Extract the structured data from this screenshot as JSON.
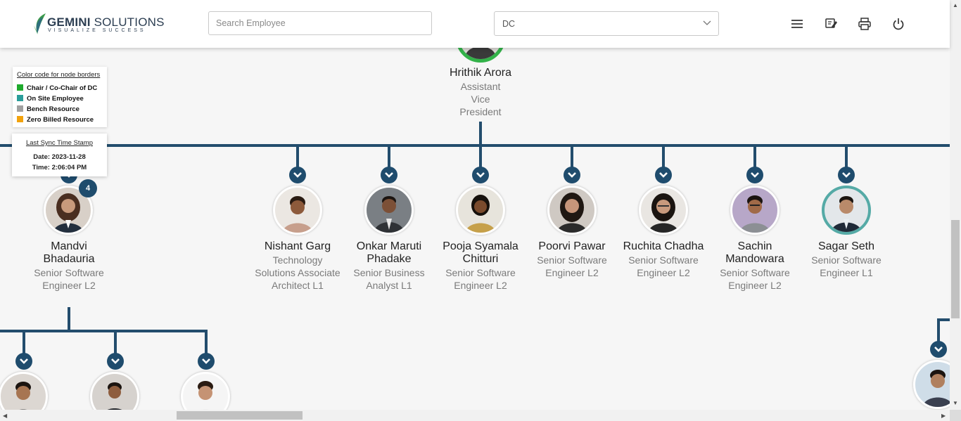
{
  "header": {
    "logo_main": "GEMINI",
    "logo_secondary": "SOLUTIONS",
    "logo_tagline": "VISUALIZE SUCCESS",
    "search_placeholder": "Search Employee",
    "select_value": "DC",
    "icons": [
      "menu-icon",
      "edit-note-icon",
      "print-icon",
      "power-icon"
    ]
  },
  "legend": {
    "title": "Color code for node borders",
    "items": [
      {
        "label": "Chair / Co-Chair of DC",
        "color": "#1faa2d"
      },
      {
        "label": "On Site Employee",
        "color": "#2a9d9a"
      },
      {
        "label": "Bench Resource",
        "color": "#a0a0a0"
      },
      {
        "label": "Zero Billed Resource",
        "color": "#f2a20c"
      }
    ]
  },
  "sync": {
    "title": "Last Sync Time Stamp",
    "date_line": "Date: 2023-11-28",
    "time_line": "Time: 2:06:04 PM"
  },
  "colors": {
    "tree_line": "#234d6d",
    "chair_border": "#33b249",
    "onsite_border": "#55aaa6"
  },
  "root": {
    "name": "Hrithik Arora",
    "role": "Assistant Vice President"
  },
  "level1": [
    {
      "name": "Mandvi Bhadauria",
      "role": "Senior Software Engineer L2",
      "badge": "4"
    },
    {
      "name": "Nishant Garg",
      "role": "Technology Solutions Associate Architect L1"
    },
    {
      "name": "Onkar Maruti Phadake",
      "role": "Senior Business Analyst L1"
    },
    {
      "name": "Pooja Syamala Chitturi",
      "role": "Senior Software Engineer L2"
    },
    {
      "name": "Poorvi Pawar",
      "role": "Senior Software Engineer L2"
    },
    {
      "name": "Ruchita Chadha",
      "role": "Senior Software Engineer L2"
    },
    {
      "name": "Sachin Mandowara",
      "role": "Senior Software Engineer L2"
    },
    {
      "name": "Sagar Seth",
      "role": "Senior Software Engineer L1"
    }
  ]
}
